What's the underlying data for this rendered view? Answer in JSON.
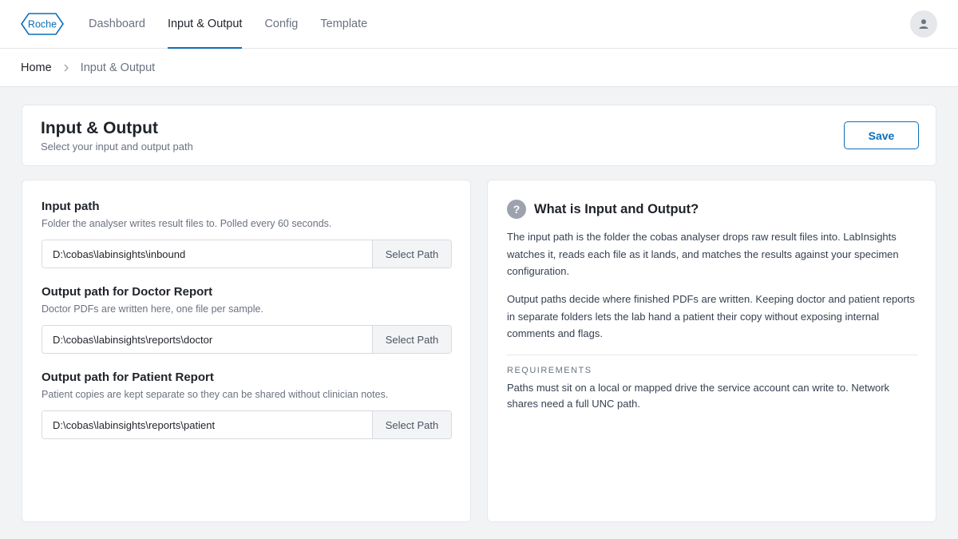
{
  "brand": {
    "logo_text": "Roche",
    "accent_color": "#0b6fb8"
  },
  "nav": {
    "items": [
      {
        "label": "Dashboard",
        "active": false
      },
      {
        "label": "Input & Output",
        "active": true
      },
      {
        "label": "Config",
        "active": false
      },
      {
        "label": "Template",
        "active": false
      }
    ],
    "avatar_icon": "user-icon"
  },
  "breadcrumb": {
    "home": "Home",
    "separator_icon": "chevron-right-icon",
    "current": "Input & Output"
  },
  "header": {
    "title": "Input & Output",
    "subtitle": "Select your input and output path",
    "save_label": "Save"
  },
  "fields": [
    {
      "label": "Input path",
      "help": "Folder the analyser writes result files to. Polled every 60 seconds.",
      "value": "D:\\cobas\\labinsights\\inbound",
      "button_label": "Select Path"
    },
    {
      "label": "Output path for Doctor Report",
      "help": "Doctor PDFs are written here, one file per sample.",
      "value": "D:\\cobas\\labinsights\\reports\\doctor",
      "button_label": "Select Path"
    },
    {
      "label": "Output path for Patient Report",
      "help": "Patient copies are kept separate so they can be shared without clinician notes.",
      "value": "D:\\cobas\\labinsights\\reports\\patient",
      "button_label": "Select Path"
    }
  ],
  "help_panel": {
    "icon": "question-icon",
    "icon_glyph": "?",
    "title": "What is Input and Output?",
    "paragraph_1": "The input path is the folder the cobas analyser drops raw result files into. LabInsights watches it, reads each file as it lands, and matches the results against your specimen configuration.",
    "paragraph_2": "Output paths decide where finished PDFs are written. Keeping doctor and patient reports in separate folders lets the lab hand a patient their copy without exposing internal comments and flags.",
    "requirements_title": "REQUIREMENTS",
    "requirements_text": "Paths must sit on a local or mapped drive the service account can write to. Network shares need a full UNC path."
  }
}
